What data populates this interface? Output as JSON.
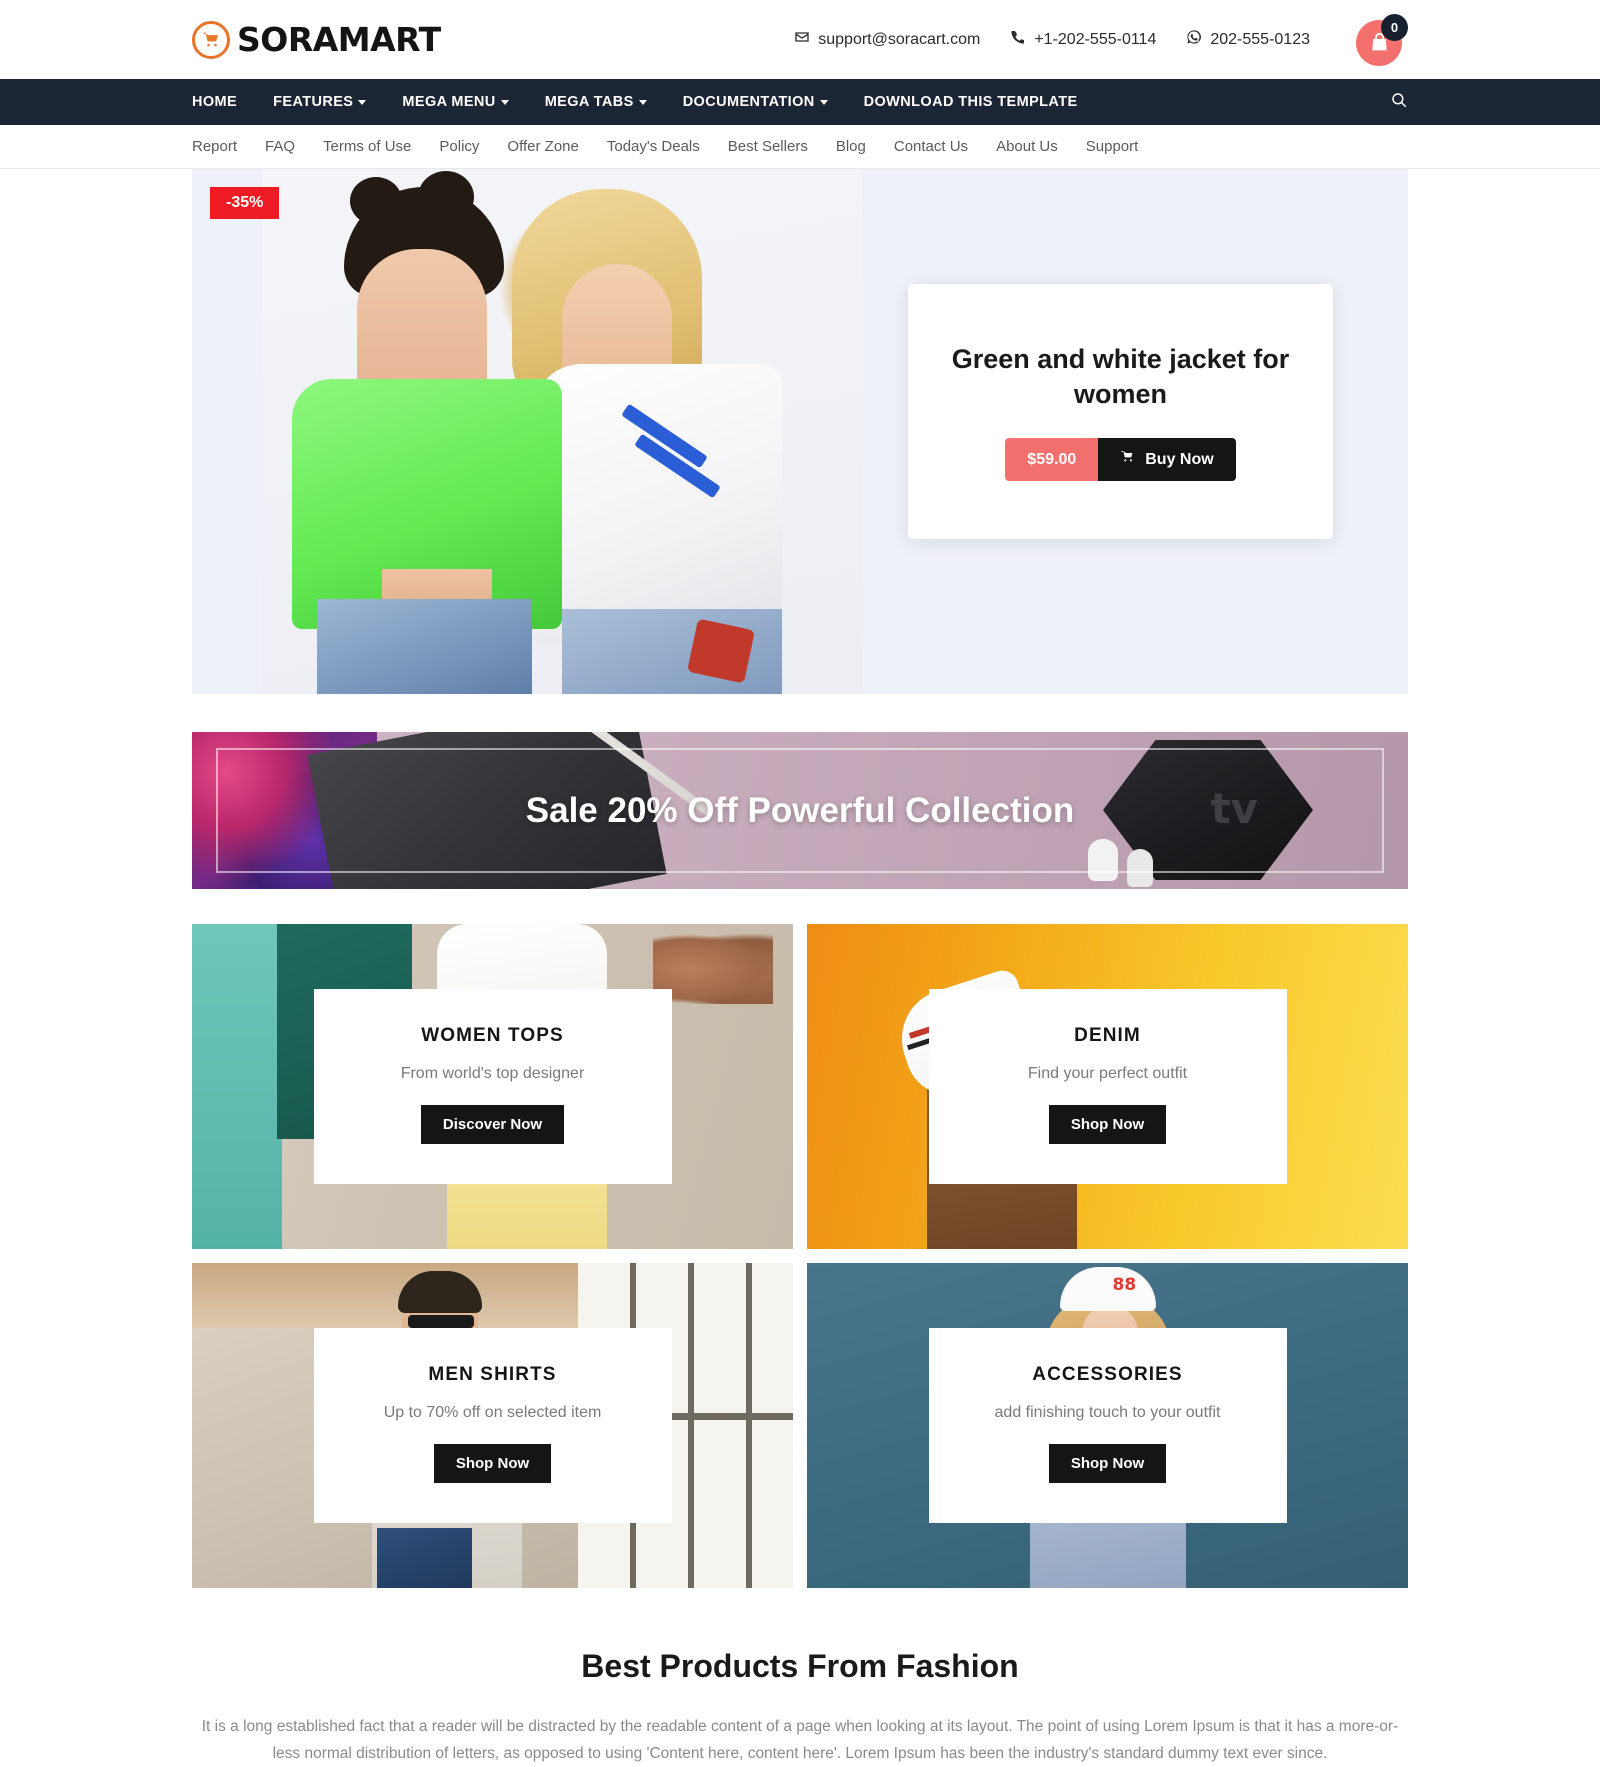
{
  "brand": {
    "name": "SORAMART",
    "logo_icon": "shopping-cart-icon",
    "accent_color": "#e8742c"
  },
  "topbar": {
    "email": "support@soracart.com",
    "email_icon": "envelope-icon",
    "phone": "+1-202-555-0114",
    "phone_icon": "phone-icon",
    "whatsapp": "202-555-0123",
    "whatsapp_icon": "whatsapp-icon",
    "cart_icon": "shopping-bag-icon",
    "cart_count": "0",
    "cart_color": "#f4706e"
  },
  "mainnav": {
    "background": "#1b2533",
    "search_icon": "search-icon",
    "items": [
      {
        "label": "HOME",
        "has_dropdown": false
      },
      {
        "label": "FEATURES",
        "has_dropdown": true
      },
      {
        "label": "MEGA MENU",
        "has_dropdown": true
      },
      {
        "label": "MEGA TABS",
        "has_dropdown": true
      },
      {
        "label": "DOCUMENTATION",
        "has_dropdown": true
      },
      {
        "label": "DOWNLOAD THIS TEMPLATE",
        "has_dropdown": false
      }
    ]
  },
  "subnav": {
    "items": [
      {
        "label": "Report"
      },
      {
        "label": "FAQ"
      },
      {
        "label": "Terms of Use"
      },
      {
        "label": "Policy"
      },
      {
        "label": "Offer Zone"
      },
      {
        "label": "Today's Deals"
      },
      {
        "label": "Best Sellers"
      },
      {
        "label": "Blog"
      },
      {
        "label": "Contact Us"
      },
      {
        "label": "About Us"
      },
      {
        "label": "Support"
      }
    ]
  },
  "hero": {
    "discount_badge": "-35%",
    "discount_color": "#ed1c24",
    "title": "Green and white jacket for women",
    "price": "$59.00",
    "price_color": "#f4706e",
    "buy_label": "Buy Now",
    "buy_icon": "cart-icon",
    "background_color": "#eef1f7"
  },
  "sale_banner": {
    "text": "Sale 20% Off Powerful Collection",
    "tv_label": "tv"
  },
  "categories": [
    {
      "title": "WOMEN TOPS",
      "subtitle": "From world's top designer",
      "button": "Discover Now"
    },
    {
      "title": "DENIM",
      "subtitle": "Find your perfect outfit",
      "button": "Shop Now"
    },
    {
      "title": "MEN SHIRTS",
      "subtitle": "Up to 70% off on selected item",
      "button": "Shop Now"
    },
    {
      "title": "ACCESSORIES",
      "subtitle": "add finishing touch to your outfit",
      "button": "Shop Now"
    }
  ],
  "best_section": {
    "title": "Best Products From Fashion",
    "paragraph": "It is a long established fact that a reader will be distracted by the readable content of a page when looking at its layout. The point of using Lorem Ipsum is that it has a more-or-less normal distribution of letters, as opposed to using 'Content here, content here'. Lorem Ipsum has been the industry's standard dummy text ever since.",
    "accessories_hat_number": "88"
  }
}
